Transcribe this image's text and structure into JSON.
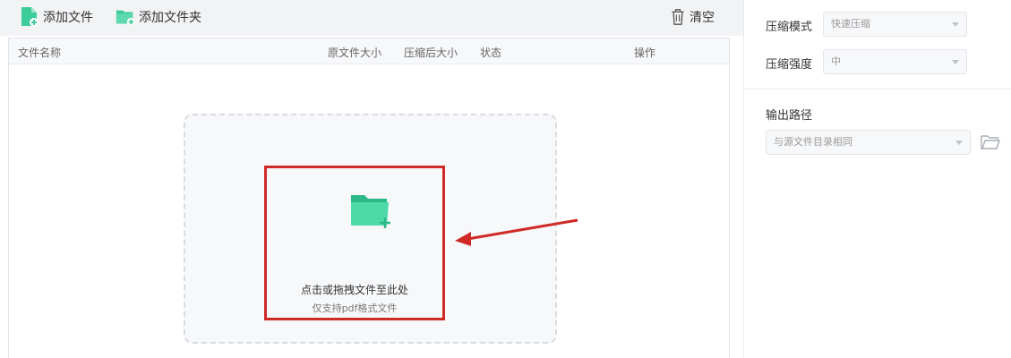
{
  "toolbar": {
    "add_file": "添加文件",
    "add_folder": "添加文件夹",
    "clear": "清空"
  },
  "file_list": {
    "columns": [
      "文件名称",
      "原文件大小",
      "压缩后大小",
      "状态",
      "操作"
    ]
  },
  "drop_zone": {
    "title": "点击或拖拽文件至此处",
    "subtitle": "仅支持pdf格式文件"
  },
  "settings": {
    "mode_label": "压缩模式",
    "mode_value": "快速压缩",
    "strength_label": "压缩强度",
    "strength_value": "中",
    "output_label": "输出路径",
    "output_value": "与源文件目录相同"
  },
  "colors": {
    "accent_green": "#3dcc9a",
    "highlight_red": "#d02a26"
  }
}
